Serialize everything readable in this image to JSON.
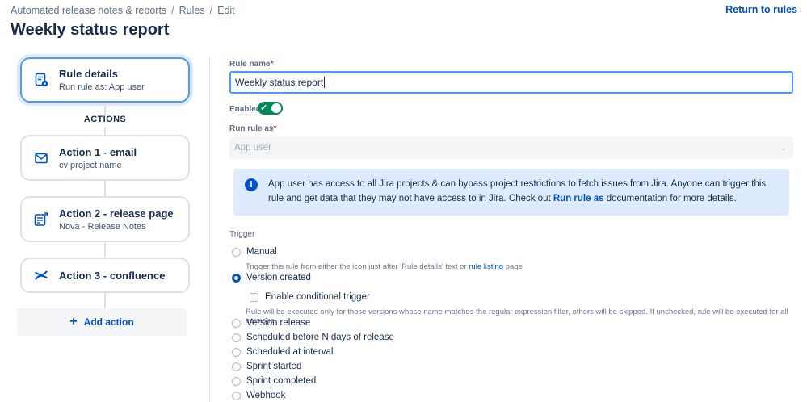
{
  "breadcrumb": {
    "root": "Automated release notes & reports",
    "sep": "/",
    "rules": "Rules",
    "edit": "Edit"
  },
  "header": {
    "title": "Weekly status report",
    "return_link": "Return to rules"
  },
  "sidebar": {
    "rule_details": {
      "title": "Rule details",
      "subtitle": "Run rule as: App user",
      "icon": "document-settings-icon"
    },
    "actions_label": "ACTIONS",
    "actions": [
      {
        "title": "Action 1 - email",
        "subtitle": "cv project name",
        "icon": "email-icon"
      },
      {
        "title": "Action 2 - release page",
        "subtitle": "Nova - Release Notes",
        "icon": "page-icon"
      },
      {
        "title": "Action 3 - confluence",
        "subtitle": "",
        "icon": "confluence-icon"
      }
    ],
    "add_action": "Add action"
  },
  "form": {
    "rule_name_label": "Rule name",
    "required_mark": "*",
    "rule_name_value": "Weekly status report",
    "enabled_label": "Enabled",
    "enabled": true,
    "run_as_label": "Run rule as",
    "run_as_value": "App user",
    "info": {
      "text_before": "App user has access to all Jira projects & can bypass project restrictions to fetch issues from Jira. Anyone can trigger this rule and get data that they may not have access to in Jira. Check out",
      "link": "Run rule as",
      "text_after": "documentation for more details."
    },
    "trigger_label": "Trigger",
    "triggers": {
      "manual": "Manual",
      "manual_help_before": "Trigger this rule from either the icon just after 'Rule details' text or",
      "manual_help_link": "rule listing",
      "manual_help_after": "page",
      "version_created": "Version created",
      "conditional": "Enable conditional trigger",
      "conditional_help": "Rule will be executed only for those versions whose name matches the regular expression filter, others will be skipped. If unchecked, rule will be executed for all versions.",
      "version_release": "Version release",
      "scheduled_before": "Scheduled before N days of release",
      "scheduled_interval": "Scheduled at interval",
      "sprint_started": "Sprint started",
      "sprint_completed": "Sprint completed",
      "webhook": "Webhook",
      "selected": "Version created"
    }
  },
  "colors": {
    "primary": "#0052cc",
    "toggle_on": "#00875a",
    "info_bg": "#deebff"
  }
}
